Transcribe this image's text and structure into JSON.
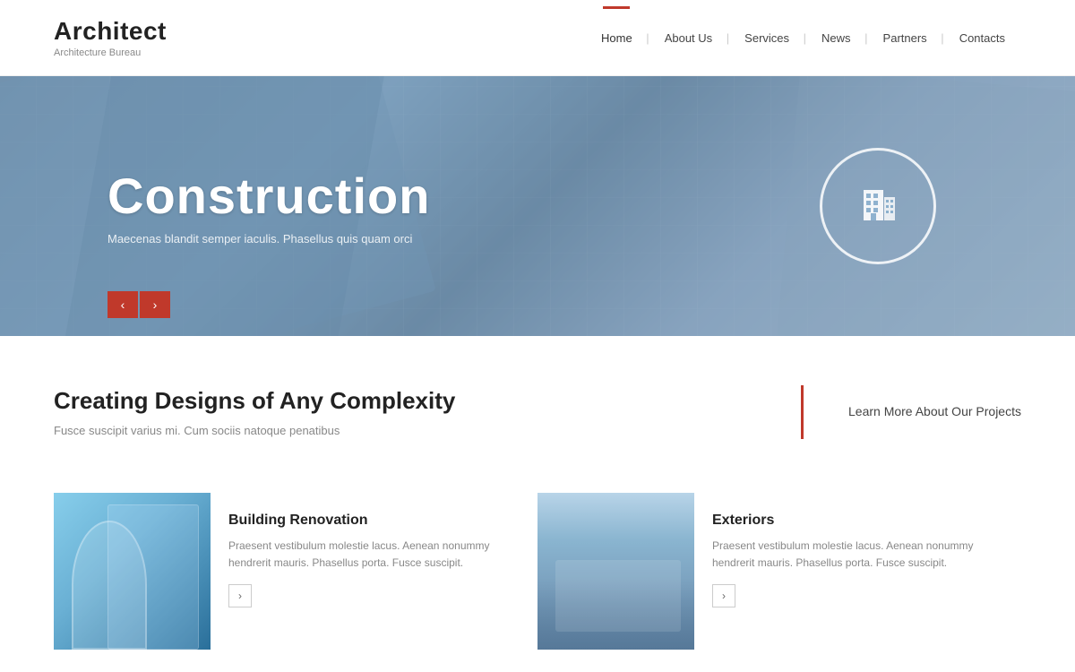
{
  "header": {
    "logo_title": "Architect",
    "logo_subtitle": "Architecture Bureau",
    "nav": {
      "items": [
        {
          "label": "Home",
          "active": true
        },
        {
          "label": "About Us",
          "active": false
        },
        {
          "label": "Services",
          "active": false
        },
        {
          "label": "News",
          "active": false
        },
        {
          "label": "Partners",
          "active": false
        },
        {
          "label": "Contacts",
          "active": false
        }
      ]
    }
  },
  "hero": {
    "title": "Construction",
    "subtitle": "Maecenas blandit semper iaculis. Phasellus quis quam orci",
    "prev_arrow": "‹",
    "next_arrow": "›"
  },
  "info": {
    "heading": "Creating Designs of Any Complexity",
    "text": "Fusce suscipit varius mi. Cum sociis natoque penatibus",
    "learn_more": "Learn More About Our Projects"
  },
  "cards": [
    {
      "title": "Building Renovation",
      "text": "Praesent vestibulum molestie lacus. Aenean nonummy hendrerit mauris. Phasellus porta. Fusce suscipit.",
      "arrow": "›",
      "image_type": "renovation"
    },
    {
      "title": "Exteriors",
      "text": "Praesent vestibulum molestie lacus. Aenean nonummy hendrerit mauris. Phasellus porta. Fusce suscipit.",
      "arrow": "›",
      "image_type": "exteriors"
    }
  ]
}
